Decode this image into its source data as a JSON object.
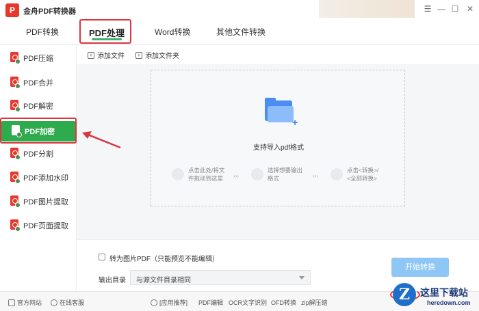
{
  "app": {
    "logo_letter": "P",
    "title": "金舟PDF转换器",
    "window_controls": {
      "menu": "☰",
      "minimize": "—",
      "maximize": "☐",
      "close": "✕"
    }
  },
  "tabs": [
    {
      "label": "PDF转换",
      "active": false
    },
    {
      "label": "PDF处理",
      "active": true
    },
    {
      "label": "Word转换",
      "active": false
    },
    {
      "label": "其他文件转换",
      "active": false
    }
  ],
  "sidebar": {
    "items": [
      {
        "label": "PDF压缩",
        "icon": "pdf-compress-icon",
        "active": false
      },
      {
        "label": "PDF合并",
        "icon": "pdf-merge-icon",
        "active": false
      },
      {
        "label": "PDF解密",
        "icon": "pdf-decrypt-icon",
        "active": false
      },
      {
        "label": "PDF加密",
        "icon": "pdf-encrypt-icon",
        "active": true
      },
      {
        "label": "PDF分割",
        "icon": "pdf-split-icon",
        "active": false
      },
      {
        "label": "PDF添加水印",
        "icon": "pdf-watermark-icon",
        "active": false
      },
      {
        "label": "PDF图片提取",
        "icon": "pdf-image-extract-icon",
        "active": false
      },
      {
        "label": "PDF页面提取",
        "icon": "pdf-page-extract-icon",
        "active": false
      }
    ]
  },
  "toolbar": {
    "add_file": "添加文件",
    "add_folder": "添加文件夹"
  },
  "dropzone": {
    "title": "支持导入pdf格式",
    "steps": [
      {
        "line1": "点击此处/将文",
        "line2": "件拖动到这里"
      },
      {
        "line1": "选择想要输出",
        "line2": "格式"
      },
      {
        "line1": "点击<转换>/",
        "line2": "<全部转换>"
      }
    ],
    "step_separator": "›››"
  },
  "options": {
    "to_image_label": "转为图片PDF（只能预览不能编辑）",
    "to_image_checked": false,
    "output_dir_label": "输出目录",
    "output_dir_value": "与源文件目录相同",
    "start_button": "开始转换"
  },
  "statusbar": {
    "website": "官方网站",
    "support": "在线客服",
    "recommend": "[应用推荐]",
    "links": [
      "PDF编辑",
      "OCR文字识别",
      "OFD转换",
      "zip解压缩"
    ]
  },
  "watermark": {
    "badge": "Z",
    "cn": "这里下载站",
    "en": "heredown.com"
  },
  "colors": {
    "accent_green": "#2eab4c",
    "highlight_red": "#d9363e",
    "start_button": "#8ec7f5",
    "folder_blue": "#4a8df5"
  }
}
